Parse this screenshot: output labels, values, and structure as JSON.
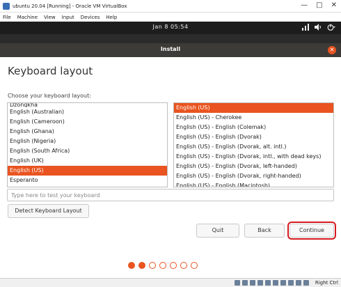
{
  "window": {
    "title": "ubuntu 20.04 [Running] - Oracle VM VirtualBox",
    "controls": [
      "—",
      "□",
      "✕"
    ]
  },
  "menubar": [
    "File",
    "Machine",
    "View",
    "Input",
    "Devices",
    "Help"
  ],
  "topbar": {
    "clock": "Jan 8  05:54",
    "tray_icons": [
      "network-icon",
      "volume-icon",
      "power-icon"
    ]
  },
  "installer": {
    "header_title": "Install",
    "close_glyph": "✕",
    "page_title": "Keyboard layout",
    "choose_label": "Choose your keyboard layout:",
    "layouts": [
      "Dzongkha",
      "English (Australian)",
      "English (Cameroon)",
      "English (Ghana)",
      "English (Nigeria)",
      "English (South Africa)",
      "English (UK)",
      "English (US)",
      "Esperanto"
    ],
    "selected_layout": "English (US)",
    "variants": [
      "English (US)",
      "English (US) - Cherokee",
      "English (US) - English (Colemak)",
      "English (US) - English (Dvorak)",
      "English (US) - English (Dvorak, alt. intl.)",
      "English (US) - English (Dvorak, intl., with dead keys)",
      "English (US) - English (Dvorak, left-handed)",
      "English (US) - English (Dvorak, right-handed)",
      "English (US) - English (Macintosh)"
    ],
    "selected_variant": "English (US)",
    "test_placeholder": "Type here to test your keyboard",
    "detect_button": "Detect Keyboard Layout",
    "quit_button": "Quit",
    "back_button": "Back",
    "continue_button": "Continue",
    "progress": {
      "current": 2,
      "total": 7
    }
  },
  "statusbar": {
    "host_key": "Right Ctrl"
  },
  "colors": {
    "accent": "#e95420",
    "highlight": "#d71920",
    "topbar": "#1d1d1d",
    "header": "#3c3b37"
  }
}
